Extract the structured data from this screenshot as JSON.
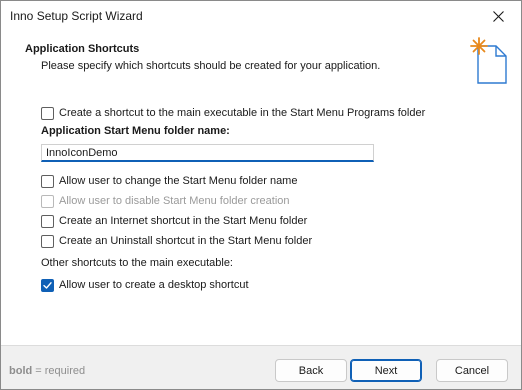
{
  "window": {
    "title": "Inno Setup Script Wizard"
  },
  "header": {
    "title": "Application Shortcuts",
    "subtitle": "Please specify which shortcuts should be created for your application.",
    "icon": "wizard-page-icon"
  },
  "options": {
    "create_start_menu": {
      "label": "Create a shortcut to the main executable in the Start Menu Programs folder",
      "checked": false
    },
    "folder_name_label": "Application Start Menu folder name:",
    "folder_name_value": "InnoIconDemo",
    "allow_change_folder": {
      "label": "Allow user to change the Start Menu folder name",
      "checked": false
    },
    "allow_disable_folder": {
      "label": "Allow user to disable Start Menu folder creation",
      "checked": false,
      "disabled": true
    },
    "internet_shortcut": {
      "label": "Create an Internet shortcut in the Start Menu folder",
      "checked": false
    },
    "uninstall_shortcut": {
      "label": "Create an Uninstall shortcut in the Start Menu folder",
      "checked": false
    },
    "other_label": "Other shortcuts to the main executable:",
    "desktop_shortcut": {
      "label": "Allow user to create a desktop shortcut",
      "checked": true
    }
  },
  "footer": {
    "hint_bold": "bold",
    "hint_rest": " = required",
    "back_label": "Back",
    "next_label": "Next",
    "cancel_label": "Cancel"
  },
  "colors": {
    "accent": "#0f60b6",
    "icon_orange": "#e8891c",
    "icon_blue": "#2e7ad1"
  }
}
